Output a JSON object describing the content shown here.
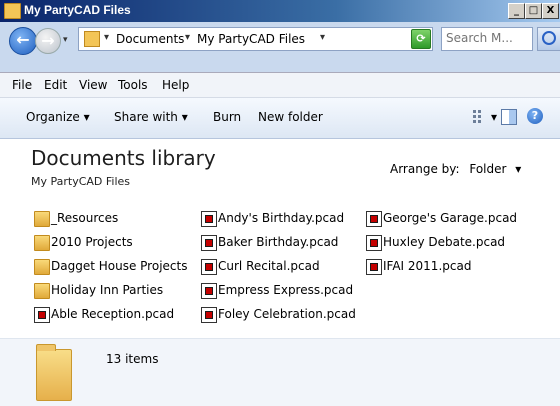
{
  "window": {
    "title": "My PartyCAD Files",
    "controls": [
      "_",
      "□",
      "X"
    ]
  },
  "address": {
    "breadcrumbs": [
      "Documents",
      "My PartyCAD Files"
    ],
    "search_placeholder": "Search M..."
  },
  "menu": [
    "File",
    "Edit",
    "View",
    "Tools",
    "Help"
  ],
  "commands": {
    "organize": "Organize",
    "share": "Share with",
    "burn": "Burn",
    "new_folder": "New folder"
  },
  "library": {
    "title": "Documents library",
    "subtitle": "My PartyCAD Files",
    "arrange_label": "Arrange by:",
    "arrange_value": "Folder"
  },
  "items": [
    {
      "name": "_Resources",
      "type": "folder"
    },
    {
      "name": "2010 Projects",
      "type": "folder"
    },
    {
      "name": "Dagget House Projects",
      "type": "folder"
    },
    {
      "name": "Holiday Inn Parties",
      "type": "folder"
    },
    {
      "name": "Able Reception.pcad",
      "type": "pcad"
    },
    {
      "name": "Andy's Birthday.pcad",
      "type": "pcad"
    },
    {
      "name": "Baker Birthday.pcad",
      "type": "pcad"
    },
    {
      "name": "Curl Recital.pcad",
      "type": "pcad"
    },
    {
      "name": "Empress Express.pcad",
      "type": "pcad"
    },
    {
      "name": "Foley Celebration.pcad",
      "type": "pcad"
    },
    {
      "name": "George's Garage.pcad",
      "type": "pcad"
    },
    {
      "name": "Huxley Debate.pcad",
      "type": "pcad"
    },
    {
      "name": "IFAI 2011.pcad",
      "type": "pcad"
    }
  ],
  "status": {
    "count": "13 items"
  },
  "colors": {
    "accent": "#2961c5",
    "folder": "#f3c557",
    "pcad_red": "#c40000"
  }
}
